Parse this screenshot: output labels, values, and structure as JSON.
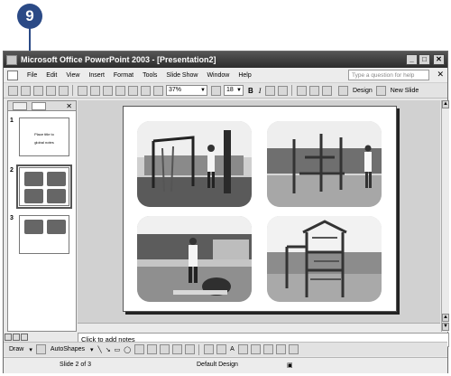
{
  "callout": {
    "number": "9"
  },
  "window": {
    "title": "Microsoft Office PowerPoint 2003 - [Presentation2]",
    "controls": [
      "_",
      "□",
      "✕"
    ]
  },
  "menubar": {
    "items": [
      "File",
      "Edit",
      "View",
      "Insert",
      "Format",
      "Tools",
      "Slide Show",
      "Window",
      "Help"
    ],
    "help_placeholder": "Type a question for help",
    "close_glyph": "✕"
  },
  "toolbar": {
    "zoom": "37%",
    "font_size": "18",
    "bold": "B",
    "italic": "I",
    "design_label": "Design",
    "new_slide_label": "New Slide"
  },
  "slides_panel": {
    "close_glyph": "✕",
    "slides": [
      {
        "number": "1",
        "lines": [
          "Place title to",
          "global notes"
        ]
      },
      {
        "number": "2"
      },
      {
        "number": "3"
      }
    ]
  },
  "notes": {
    "placeholder": "Click to add notes"
  },
  "drawing": {
    "draw_label": "Draw",
    "autoshapes_label": "AutoShapes"
  },
  "status": {
    "slide": "Slide 2 of 3",
    "design": "Default Design"
  },
  "colors": {
    "callout": "#2b4a86",
    "titlebar": "#3a3a3a"
  },
  "icons": [
    "file-icon",
    "save-icon",
    "print-icon",
    "cut-icon",
    "copy-icon",
    "paste-icon",
    "undo-icon",
    "redo-icon",
    "table-icon",
    "chart-icon",
    "align-left-icon",
    "align-center-icon",
    "bullets-icon",
    "numbering-icon",
    "line-icon",
    "arrow-icon",
    "rectangle-icon",
    "oval-icon",
    "textbox-icon",
    "wordart-icon",
    "clipart-icon",
    "picture-icon"
  ]
}
